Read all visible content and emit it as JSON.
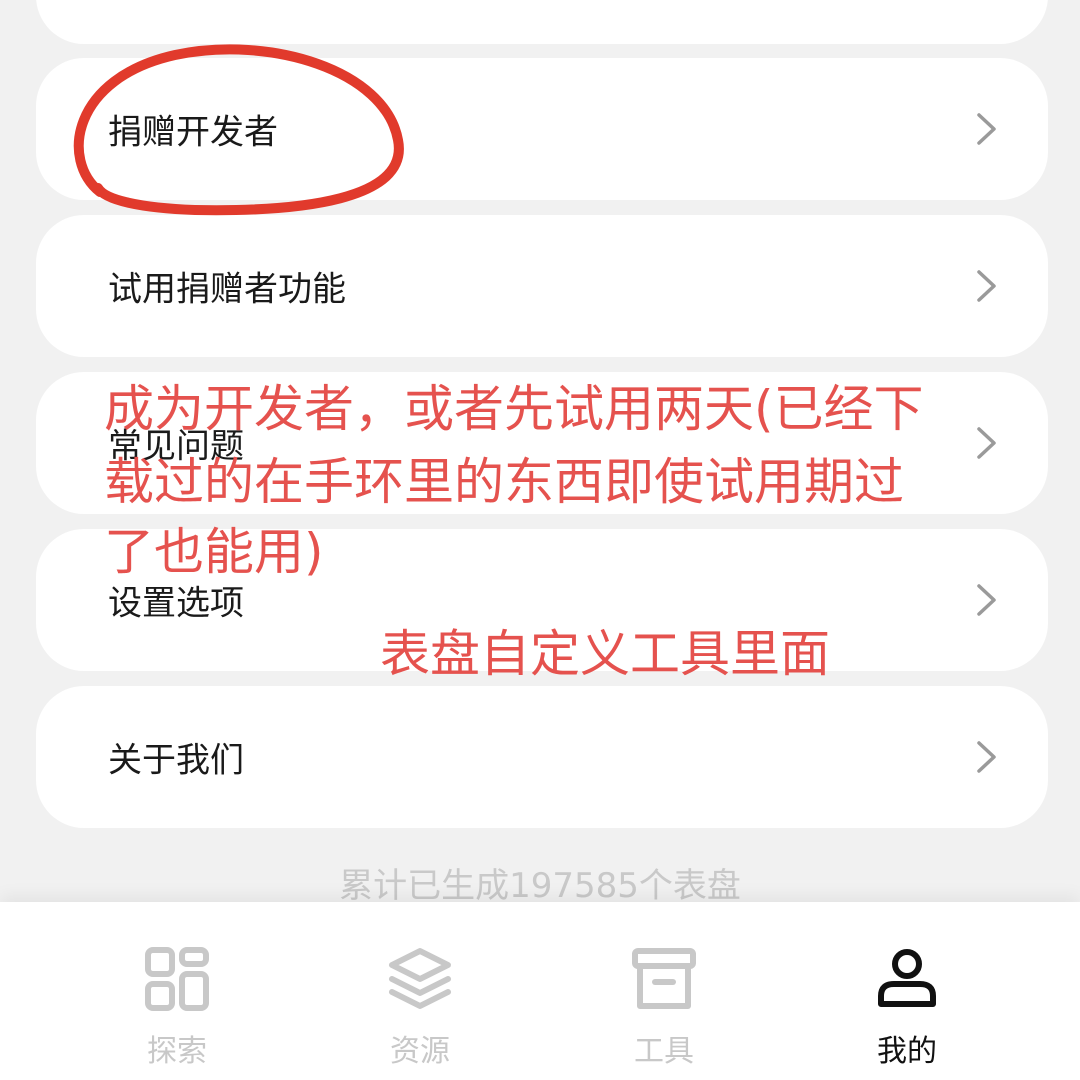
{
  "menu": {
    "items": [
      {
        "label": "捐赠开发者"
      },
      {
        "label": "试用捐赠者功能"
      },
      {
        "label": "常见问题"
      },
      {
        "label": "设置选项"
      },
      {
        "label": "关于我们"
      }
    ]
  },
  "stats_text": "累计已生成197585个表盘",
  "tabbar": {
    "tabs": [
      {
        "label": "探索",
        "icon": "grid-icon"
      },
      {
        "label": "资源",
        "icon": "layers-icon"
      },
      {
        "label": "工具",
        "icon": "archive-box-icon"
      },
      {
        "label": "我的",
        "icon": "user-icon"
      }
    ],
    "active": "我的"
  },
  "annotations": {
    "line1": "成为开发者，或者先试用两天(已经下",
    "line2": "载过的在手环里的东西即使试用期过",
    "line3": "了也能用)",
    "line4": "表盘自定义工具里面",
    "color": "#e5524e"
  },
  "colors": {
    "background": "#f1f1f1",
    "card": "#ffffff",
    "active_tab": "#111111",
    "inactive_tab": "#c8c8c8"
  }
}
